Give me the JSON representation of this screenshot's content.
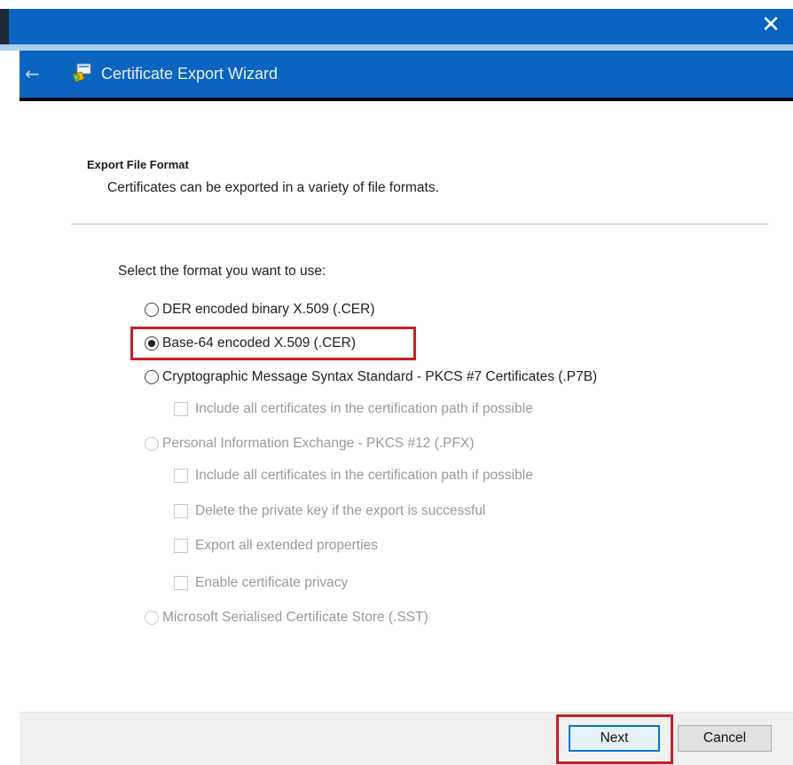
{
  "window": {
    "close_glyph": "✕"
  },
  "wizard": {
    "title": "Certificate Export Wizard",
    "back_glyph": "←"
  },
  "section": {
    "heading": "Export File Format",
    "subtitle": "Certificates can be exported in a variety of file formats."
  },
  "prompt": "Select the format you want to use:",
  "formats": [
    {
      "label": "DER encoded binary X.509 (.CER)",
      "checked": false,
      "enabled": true
    },
    {
      "label": "Base-64 encoded X.509 (.CER)",
      "checked": true,
      "enabled": true,
      "highlighted": true
    },
    {
      "label": "Cryptographic Message Syntax Standard - PKCS #7 Certificates (.P7B)",
      "checked": false,
      "enabled": true
    },
    {
      "label": "Personal Information Exchange - PKCS #12 (.PFX)",
      "checked": false,
      "enabled": false
    },
    {
      "label": "Microsoft Serialised Certificate Store (.SST)",
      "checked": false,
      "enabled": false
    }
  ],
  "pkcs7_options": [
    {
      "label": "Include all certificates in the certification path if possible",
      "checked": false,
      "enabled": false
    }
  ],
  "pfx_options": [
    {
      "label": "Include all certificates in the certification path if possible",
      "checked": false,
      "enabled": false
    },
    {
      "label": "Delete the private key if the export is successful",
      "checked": false,
      "enabled": false
    },
    {
      "label": "Export all extended properties",
      "checked": false,
      "enabled": false
    },
    {
      "label": "Enable certificate privacy",
      "checked": false,
      "enabled": false
    }
  ],
  "buttons": {
    "next": "Next",
    "cancel": "Cancel"
  },
  "colors": {
    "titlebar": "#0a64c0",
    "highlight": "#c62026",
    "default_button_border": "#0078d7"
  }
}
